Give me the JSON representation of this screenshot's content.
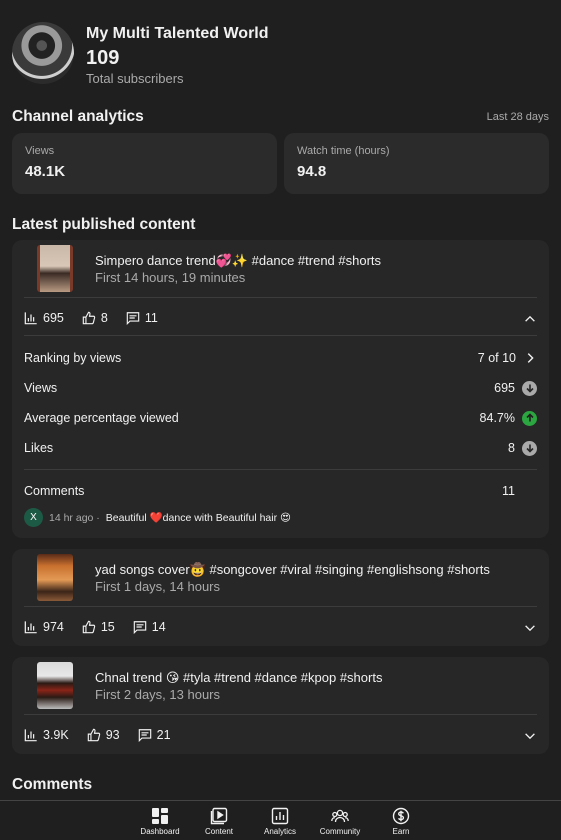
{
  "channel": {
    "name": "My Multi Talented World",
    "subscribers": "109",
    "subscribers_label": "Total subscribers"
  },
  "analytics": {
    "title": "Channel analytics",
    "period": "Last 28 days",
    "stats": [
      {
        "label": "Views",
        "value": "48.1K"
      },
      {
        "label": "Watch time (hours)",
        "value": "94.8"
      }
    ]
  },
  "latest": {
    "title": "Latest published content",
    "items": [
      {
        "title": "Simpero dance trend💞✨ #dance #trend #shorts",
        "subtitle": "First 14 hours, 19 minutes",
        "views": "695",
        "likes": "8",
        "comments": "11",
        "expanded": true,
        "details": {
          "ranking_label": "Ranking by views",
          "ranking_value": "7 of 10",
          "views_label": "Views",
          "views_value": "695",
          "avg_label": "Average percentage viewed",
          "avg_value": "84.7%",
          "likes_label": "Likes",
          "likes_value": "8",
          "comments_label": "Comments",
          "comments_value": "11",
          "recent_comment": {
            "avatar": "X",
            "time": "14 hr ago ·",
            "text_a": "Beautiful",
            "text_b": "dance with Beautiful hair",
            "emoji_end": "😍"
          }
        }
      },
      {
        "title": "yad songs cover🤠 #songcover #viral #singing #englishsong #shorts",
        "subtitle": "First 1 days, 14 hours",
        "views": "974",
        "likes": "15",
        "comments": "14",
        "expanded": false
      },
      {
        "title": "Chnal trend 😘 #tyla #trend #dance #kpop #shorts",
        "subtitle": "First 2 days, 13 hours",
        "views": "3.9K",
        "likes": "93",
        "comments": "21",
        "expanded": false
      }
    ]
  },
  "comments_section": {
    "title": "Comments"
  },
  "nav": [
    {
      "label": "Dashboard",
      "icon": "dashboard-icon"
    },
    {
      "label": "Content",
      "icon": "content-icon"
    },
    {
      "label": "Analytics",
      "icon": "analytics-icon"
    },
    {
      "label": "Community",
      "icon": "community-icon"
    },
    {
      "label": "Earn",
      "icon": "earn-icon"
    }
  ],
  "colors": {
    "background": "#1f1f1f",
    "card": "#272727",
    "up": "#2ba640",
    "down": "#aaaaaa"
  }
}
